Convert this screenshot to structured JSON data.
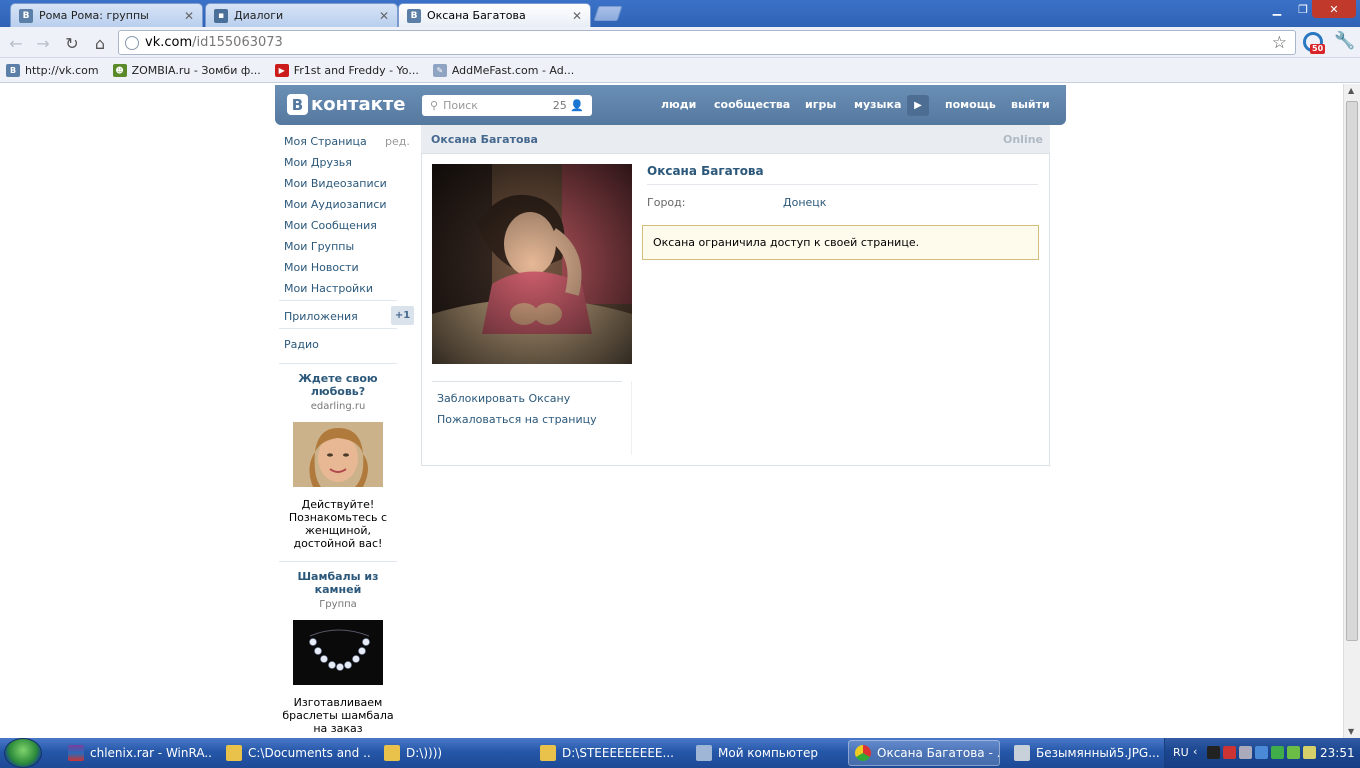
{
  "browser": {
    "tabs": [
      {
        "title": "Рома Рома: группы",
        "icon": "vk-favicon"
      },
      {
        "title": "Диалоги",
        "icon": "chat-favicon"
      },
      {
        "title": "Оксана Багатова",
        "icon": "vk-favicon",
        "active": true
      }
    ],
    "url_host": "vk.com",
    "url_path": "/id155063073",
    "extension_badge": "50",
    "bookmarks": [
      {
        "label": "http://vk.com",
        "icon": "vk-favicon"
      },
      {
        "label": "ZOMBIA.ru - Зомби ф...",
        "icon": "zombia-favicon"
      },
      {
        "label": "Fr1st and Freddy - Yo...",
        "icon": "youtube-favicon"
      },
      {
        "label": "AddMeFast.com - Ad...",
        "icon": "addmefast-favicon"
      }
    ]
  },
  "vk": {
    "logo_text": "контакте",
    "search_placeholder": "Поиск",
    "search_count": "25",
    "nav": [
      "люди",
      "сообщества",
      "игры",
      "музыка",
      "помощь",
      "выйти"
    ],
    "menu": {
      "my_page": "Моя Страница",
      "edit": "ред.",
      "items": [
        "Мои Друзья",
        "Мои Видеозаписи",
        "Мои Аудиозаписи",
        "Мои Сообщения",
        "Мои Группы",
        "Мои Новости",
        "Мои Настройки"
      ],
      "apps": "Приложения",
      "apps_badge": "+1",
      "radio": "Радио"
    },
    "ads": [
      {
        "title": "Ждете свою любовь?",
        "subtitle": "edarling.ru",
        "text": "Действуйте! Познакомьтесь с женщиной, достойной вас!"
      },
      {
        "title": "Шамбалы из камней",
        "subtitle": "Группа",
        "text": "Изготавливаем браслеты шамбала на заказ"
      }
    ],
    "profile": {
      "header_name": "Оксана Багатова",
      "status": "Online",
      "name": "Оксана Багатова",
      "city_label": "Город:",
      "city_value": "Донецк",
      "restricted_message": "Оксана ограничила доступ к своей странице.",
      "actions": [
        "Заблокировать Оксану",
        "Пожаловаться на страницу"
      ]
    }
  },
  "taskbar": {
    "tasks": [
      {
        "label": "chlenix.rar - WinRA..."
      },
      {
        "label": "C:\\Documents and ..."
      },
      {
        "label": "D:\\))))"
      },
      {
        "label": "D:\\STEEEEEEEEE..."
      },
      {
        "label": "Мой компьютер"
      },
      {
        "label": "Оксана Багатова - ...",
        "active": true
      },
      {
        "label": "Безымянный5.JPG..."
      }
    ],
    "lang": "RU",
    "clock": "23:51"
  },
  "colors": {
    "vk_header": "#5b7fa6",
    "vk_link": "#2b587a",
    "notice_bg": "#fefaec",
    "notice_border": "#d4bd7a"
  }
}
